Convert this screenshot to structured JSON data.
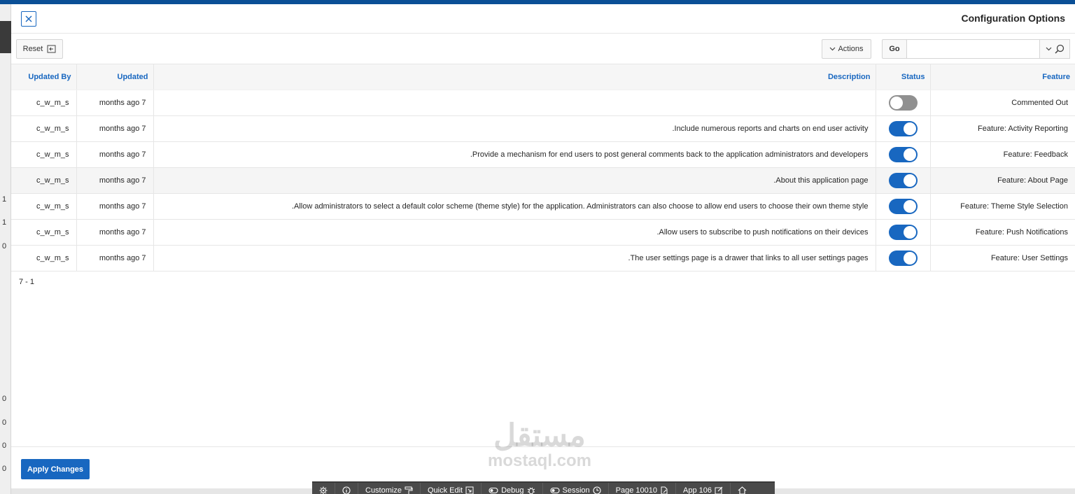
{
  "dialog": {
    "title": "Configuration Options"
  },
  "toolbar": {
    "reset_label": "Reset",
    "actions_label": "Actions",
    "go_label": "Go",
    "search_value": ""
  },
  "table": {
    "columns": {
      "updated_by": "Updated By",
      "updated": "Updated",
      "description": "Description",
      "status": "Status",
      "feature": "Feature"
    },
    "rows": [
      {
        "updated_by": "c_w_m_s",
        "updated": "months ago 7",
        "description": "",
        "status": "off",
        "feature": "Commented Out"
      },
      {
        "updated_by": "c_w_m_s",
        "updated": "months ago 7",
        "description": ".Include numerous reports and charts on end user activity",
        "status": "on",
        "feature": "Feature: Activity Reporting"
      },
      {
        "updated_by": "c_w_m_s",
        "updated": "months ago 7",
        "description": ".Provide a mechanism for end users to post general comments back to the application administrators and developers",
        "status": "on",
        "feature": "Feature: Feedback"
      },
      {
        "updated_by": "c_w_m_s",
        "updated": "months ago 7",
        "description": ".About this application page",
        "status": "on",
        "feature": "Feature: About Page"
      },
      {
        "updated_by": "c_w_m_s",
        "updated": "months ago 7",
        "description": ".Allow administrators to select a default color scheme (theme style) for the application. Administrators can also choose to allow end users to choose their own theme style",
        "status": "on",
        "feature": "Feature: Theme Style Selection"
      },
      {
        "updated_by": "c_w_m_s",
        "updated": "months ago 7",
        "description": ".Allow users to subscribe to push notifications on their devices",
        "status": "on",
        "feature": "Feature: Push Notifications"
      },
      {
        "updated_by": "c_w_m_s",
        "updated": "months ago 7",
        "description": ".The user settings page is a drawer that links to all user settings pages",
        "status": "on",
        "feature": "Feature: User Settings"
      }
    ],
    "pagination": "7 - 1"
  },
  "footer": {
    "apply_label": "Apply Changes"
  },
  "watermark": {
    "arabic": "مستقل",
    "latin": "mostaql.com"
  },
  "devbar": {
    "customize": "Customize",
    "quick_edit": "Quick Edit",
    "debug": "Debug",
    "session": "Session",
    "page": "Page 10010",
    "app": "App 106"
  },
  "background": {
    "left_numbers": [
      "1",
      "1",
      "0",
      "0",
      "0",
      "0",
      "0"
    ]
  },
  "colors": {
    "accent": "#1867c0",
    "toggle_off": "#909090",
    "topbar": "#0a4f96",
    "devbar": "#4a4a4a"
  }
}
